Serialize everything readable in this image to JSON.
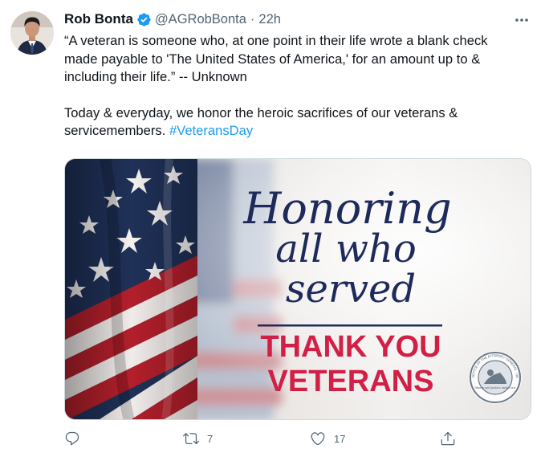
{
  "tweet": {
    "author_name": "Rob Bonta",
    "handle": "@AGRobBonta",
    "separator": "·",
    "time": "22h",
    "text_paragraph_1": "“A veteran is someone who, at one point in their life wrote a blank check\nmade payable to 'The United States of America,' for an amount up to &\nincluding their life.” -- Unknown",
    "text_paragraph_2_prefix": "Today & everyday, we honor the heroic sacrifices of our veterans &\nservicemembers. ",
    "hashtag": "#VeteransDay",
    "image": {
      "script_line_1": "Honoring",
      "script_line_2": "all who",
      "script_line_3": "served",
      "headline_1": "THANK YOU",
      "headline_2": "VETERANS",
      "seal_text": "OFFICE OF THE ATTORNEY GENERAL · DEPARTMENT OF JUSTICE",
      "seal_motto": "liberty and justice under law"
    },
    "actions": {
      "reply_count": "",
      "retweet_count": "7",
      "like_count": "17"
    }
  },
  "colors": {
    "link": "#1d9bf0",
    "secondary_text": "#536471",
    "verified_badge": "#1d9bf0",
    "script_navy": "#1d2a5a",
    "headline_red": "#d11f45"
  },
  "icons": [
    "verified-icon",
    "more-icon",
    "reply-icon",
    "retweet-icon",
    "like-icon",
    "share-icon"
  ]
}
